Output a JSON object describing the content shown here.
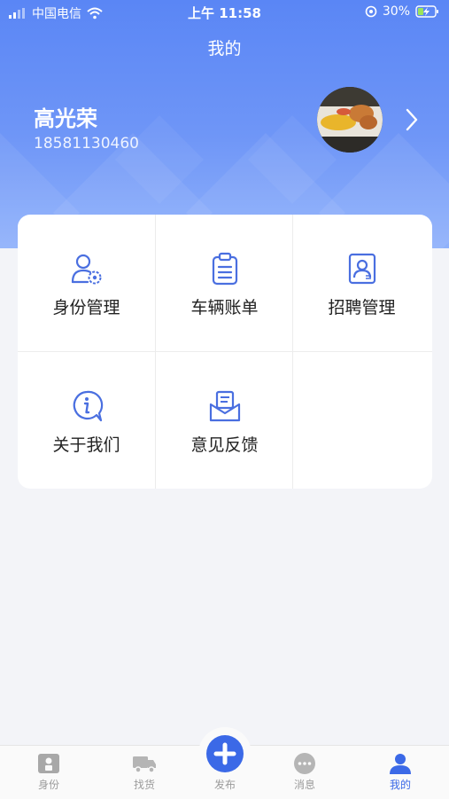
{
  "status_bar": {
    "carrier": "中国电信",
    "time": "上午 11:58",
    "battery": "30%"
  },
  "page": {
    "title": "我的"
  },
  "profile": {
    "name": "高光荣",
    "phone": "18581130460"
  },
  "menu": [
    {
      "label": "身份管理",
      "icon": "user-settings-icon"
    },
    {
      "label": "车辆账单",
      "icon": "clipboard-icon"
    },
    {
      "label": "招聘管理",
      "icon": "id-card-icon"
    },
    {
      "label": "关于我们",
      "icon": "info-chat-icon"
    },
    {
      "label": "意见反馈",
      "icon": "feedback-mail-icon"
    }
  ],
  "tabbar": {
    "items": [
      {
        "label": "身份",
        "icon": "id-badge-icon"
      },
      {
        "label": "找货",
        "icon": "truck-icon"
      },
      {
        "label": "发布",
        "icon": "plus-icon"
      },
      {
        "label": "消息",
        "icon": "chat-dots-icon"
      },
      {
        "label": "我的",
        "icon": "person-icon"
      }
    ],
    "active_index": 4
  },
  "colors": {
    "accent": "#3b69e7",
    "icon_blue": "#4a6fe0",
    "header_top": "#5a86f5",
    "inactive": "#9b9b9b"
  }
}
